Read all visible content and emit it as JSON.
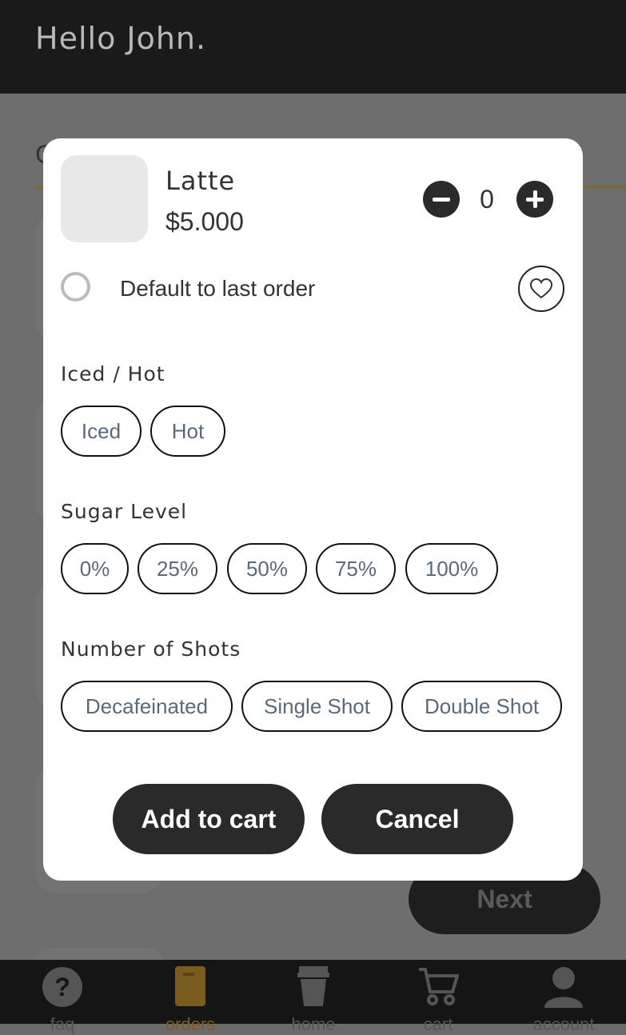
{
  "header": {
    "greeting": "Hello John."
  },
  "background": {
    "partial_label": "C",
    "next_label": "Next"
  },
  "nav": [
    {
      "label": "faq",
      "icon": "question-circle-icon",
      "active": false
    },
    {
      "label": "orders",
      "icon": "menu-book-icon",
      "active": true
    },
    {
      "label": "home",
      "icon": "coffee-cup-icon",
      "active": false
    },
    {
      "label": "cart",
      "icon": "cart-icon",
      "active": false
    },
    {
      "label": "account",
      "icon": "person-icon",
      "active": false
    }
  ],
  "modal": {
    "product": {
      "name": "Latte",
      "price": "$5.000",
      "quantity": "0"
    },
    "default_label": "Default to last order",
    "sections": {
      "temp": {
        "title": "Iced / Hot",
        "options": [
          "Iced",
          "Hot"
        ]
      },
      "sugar": {
        "title": "Sugar Level",
        "options": [
          "0%",
          "25%",
          "50%",
          "75%",
          "100%"
        ]
      },
      "shots": {
        "title": "Number of Shots",
        "options": [
          "Decafeinated",
          "Single Shot",
          "Double Shot"
        ]
      }
    },
    "add_label": "Add to cart",
    "cancel_label": "Cancel"
  },
  "colors": {
    "accent_gold": "#7a5d1e",
    "dark": "#2a2a2a",
    "chip_text": "#5a6a7a"
  }
}
